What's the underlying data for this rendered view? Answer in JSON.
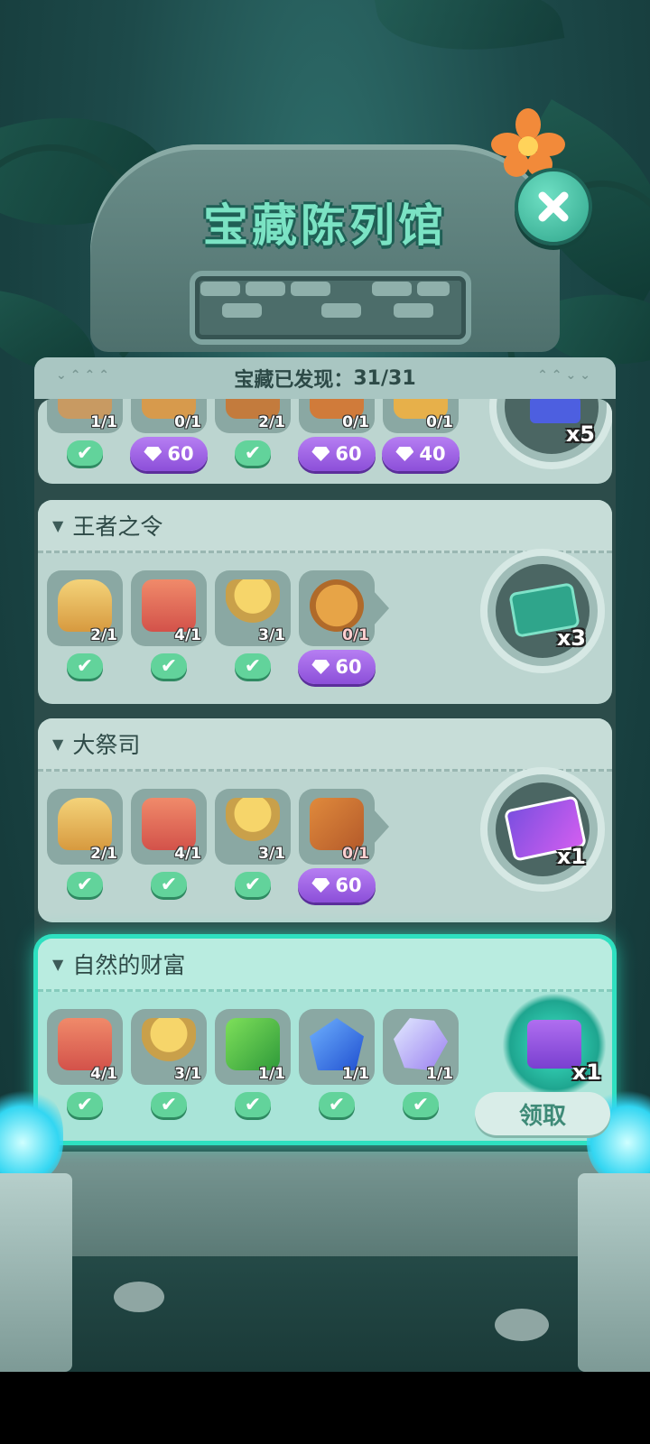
{
  "title": "宝藏陈列馆",
  "discovered": {
    "label": "宝藏已发现：",
    "value": "31/31"
  },
  "top_card": {
    "items": [
      {
        "count": "1/1",
        "status": "check"
      },
      {
        "count": "0/1",
        "status": "gems",
        "cost": "60"
      },
      {
        "count": "2/1",
        "status": "check"
      },
      {
        "count": "0/1",
        "status": "gems",
        "cost": "60"
      },
      {
        "count": "0/1",
        "status": "gems",
        "cost": "40"
      }
    ],
    "reward_mult": "x5"
  },
  "cards": [
    {
      "name": "王者之令",
      "items": [
        {
          "count": "2/1",
          "status": "check",
          "icon": "crown-icon"
        },
        {
          "count": "4/1",
          "status": "check",
          "icon": "banner-icon"
        },
        {
          "count": "3/1",
          "status": "check",
          "icon": "torch-icon"
        },
        {
          "count": "0/1",
          "status": "gems",
          "cost": "60",
          "icon": "coin-icon"
        }
      ],
      "reward_mult": "x3",
      "reward_icon": "eye-ticket-icon"
    },
    {
      "name": "大祭司",
      "items": [
        {
          "count": "2/1",
          "status": "check",
          "icon": "crown-icon"
        },
        {
          "count": "4/1",
          "status": "check",
          "icon": "banner-icon"
        },
        {
          "count": "3/1",
          "status": "check",
          "icon": "torch-icon"
        },
        {
          "count": "0/1",
          "status": "gems",
          "cost": "60",
          "icon": "book-icon"
        }
      ],
      "reward_mult": "x1",
      "reward_icon": "card-pack-icon"
    },
    {
      "name": "自然的财富",
      "items": [
        {
          "count": "4/1",
          "status": "check",
          "icon": "banner-icon"
        },
        {
          "count": "3/1",
          "status": "check",
          "icon": "torch-icon"
        },
        {
          "count": "1/1",
          "status": "check",
          "icon": "green-cube-icon"
        },
        {
          "count": "1/1",
          "status": "check",
          "icon": "blue-crystal-icon"
        },
        {
          "count": "1/1",
          "status": "check",
          "icon": "pink-gem-icon"
        }
      ],
      "reward_mult": "x1",
      "reward_icon": "gift-box-icon",
      "claim_label": "领取"
    }
  ],
  "colors": {
    "accent": "#2ee0c0",
    "gem_button": "#a766ea",
    "check": "#62d39b"
  }
}
